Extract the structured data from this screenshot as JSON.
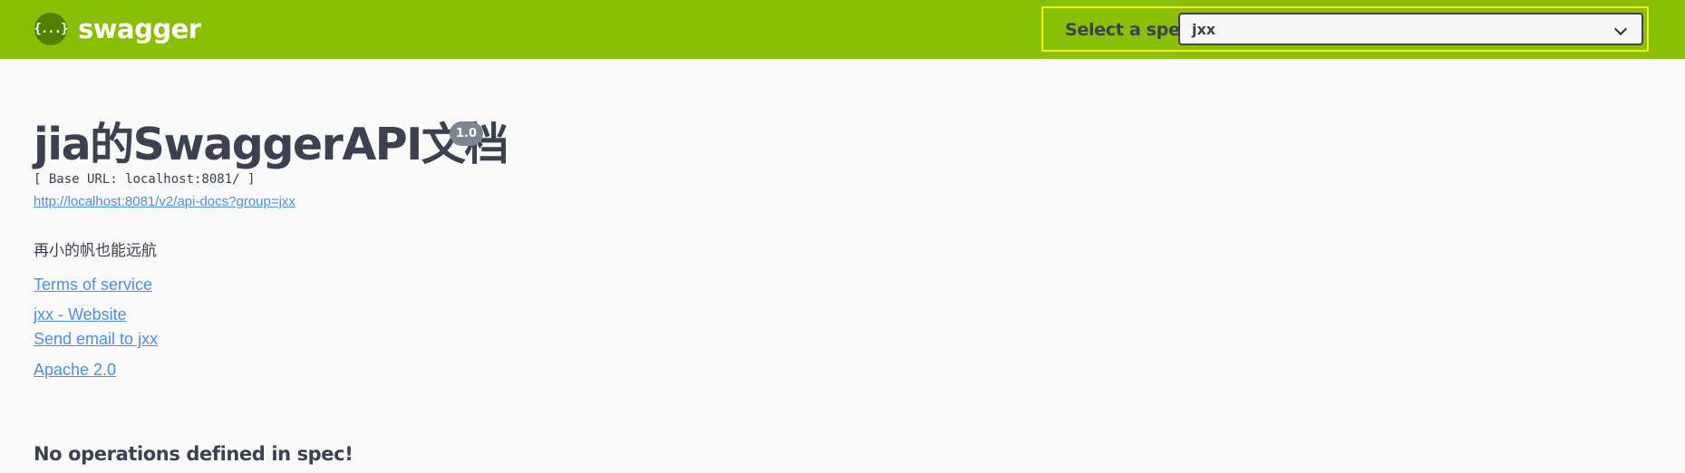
{
  "topbar": {
    "logo_icon_text": "{...}",
    "logo_text": "swagger",
    "spec_label": "Select a spec",
    "spec_selected": "jxx",
    "background_color": "#89bf04",
    "highlight_color": "#f5f200"
  },
  "info": {
    "title": "jia的SwaggerAPI文档",
    "version": "1.0",
    "base_url": "[ Base URL: localhost:8081/ ]",
    "api_docs_url": "http://localhost:8081/v2/api-docs?group=jxx",
    "description": "再小的帆也能远航",
    "terms_link": "Terms of service",
    "website_link": "jxx - Website",
    "email_link": "Send email to jxx",
    "license_link": "Apache 2.0"
  },
  "operations": {
    "empty_message": "No operations defined in spec!"
  },
  "colors": {
    "link": "#4990e2",
    "text": "#3b4151",
    "version_badge": "#7d8492"
  }
}
